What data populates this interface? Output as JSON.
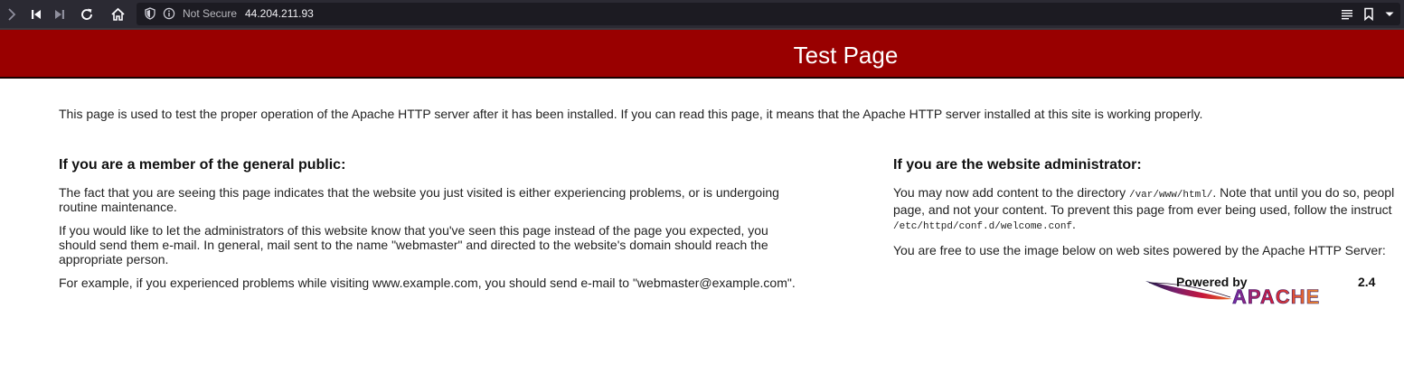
{
  "browser": {
    "security_label": "Not Secure",
    "url": "44.204.211.93",
    "icons": [
      "forward-arrow-icon",
      "skip-back-icon",
      "skip-forward-icon",
      "reload-icon",
      "home-icon",
      "shield-icon",
      "info-icon",
      "reader-mode-icon",
      "bookmark-icon",
      "dropdown-arrow-icon"
    ]
  },
  "page": {
    "title": "Test Page",
    "lead": "This page is used to test the proper operation of the Apache HTTP server after it has been installed. If you can read this page, it means that the Apache HTTP server installed at this site is working properly.",
    "public": {
      "heading": "If you are a member of the general public:",
      "p1": "The fact that you are seeing this page indicates that the website you just visited is either experiencing problems, or is undergoing routine maintenance.",
      "p2": "If you would like to let the administrators of this website know that you've seen this page instead of the page you expected, you should send them e-mail. In general, mail sent to the name \"webmaster\" and directed to the website's domain should reach the appropriate person.",
      "p3": "For example, if you experienced problems while visiting www.example.com, you should send e-mail to \"webmaster@example.com\"."
    },
    "admin": {
      "heading": "If you are the website administrator:",
      "p1_a": "You may now add content to the directory ",
      "p1_dir": "/var/www/html/",
      "p1_b": ". Note that until you do so, peopl",
      "p1_line2": "page, and not your content. To prevent this page from ever being used, follow the instruct",
      "p1_conf": "/etc/httpd/conf.d/welcome.conf",
      "p1_conf_tail": ".",
      "p2": "You are free to use the image below on web sites powered by the Apache HTTP Server:"
    },
    "badge": {
      "powered_by": "Powered by",
      "brand": "APACHE",
      "version": "2.4"
    }
  }
}
